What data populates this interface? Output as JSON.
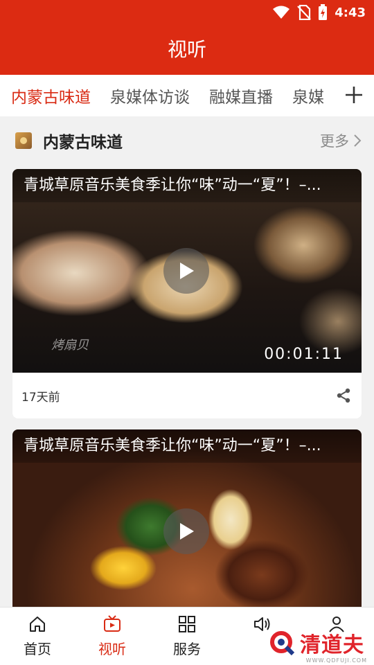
{
  "status_bar": {
    "time": "4:43",
    "icons": [
      "wifi-icon",
      "no-sim-icon",
      "battery-icon"
    ]
  },
  "header": {
    "title": "视听"
  },
  "tabs": [
    {
      "label": "内蒙古味道",
      "active": true
    },
    {
      "label": "泉媒体访谈",
      "active": false
    },
    {
      "label": "融媒直播",
      "active": false
    },
    {
      "label": "泉媒",
      "active": false
    }
  ],
  "section": {
    "title": "内蒙古味道",
    "more_label": "更多"
  },
  "cards": [
    {
      "title": "青城草原音乐美食季让你“味”动一“夏”！–...",
      "duration": "00:01:11",
      "watermark": "烤扇贝",
      "age": "17天前"
    },
    {
      "title": "青城草原音乐美食季让你“味”动一“夏”！–...",
      "age": ""
    }
  ],
  "bottom_nav": [
    {
      "label": "首页",
      "icon": "home-icon",
      "active": false
    },
    {
      "label": "视听",
      "icon": "tv-icon",
      "active": true
    },
    {
      "label": "服务",
      "icon": "grid-icon",
      "active": false
    },
    {
      "label": "",
      "icon": "speaker-icon",
      "active": false
    },
    {
      "label": "",
      "icon": "user-icon",
      "active": false
    }
  ],
  "watermark_logo": {
    "text": "清道夫",
    "url": "WWW.QDFUJI.COM"
  },
  "colors": {
    "brand_red": "#dc2b12",
    "active_tab": "#d92b14",
    "background": "#f1f1f1"
  }
}
